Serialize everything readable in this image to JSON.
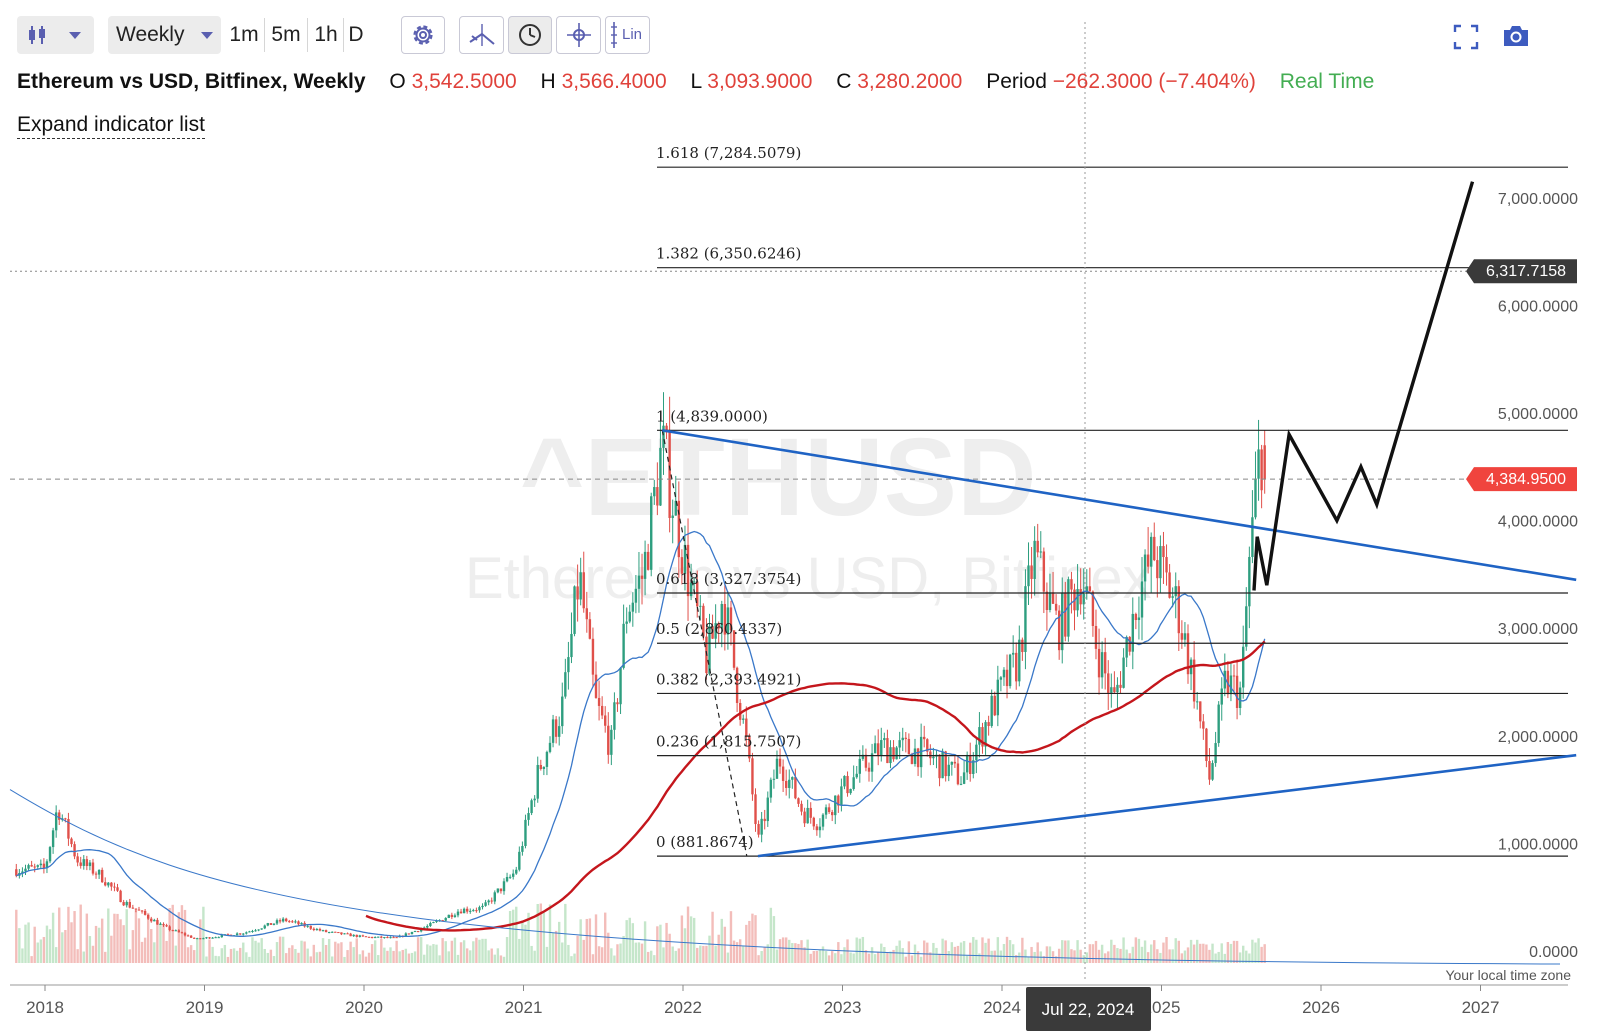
{
  "toolbar": {
    "chart_type_icon": "candlestick-icon",
    "timeframe": "Weekly",
    "intervals": [
      "1m",
      "5m",
      "1h",
      "D"
    ],
    "tools": [
      "gear-icon",
      "draw-tool-icon",
      "clock-icon",
      "crosshair-icon",
      "lin-scale-icon"
    ],
    "lin_label": "Lin",
    "fullscreen_icon": "fullscreen-icon",
    "camera_icon": "camera-icon"
  },
  "legend": {
    "title": "Ethereum vs USD, Bitfinex, Weekly",
    "open_label": "O",
    "open": "3,542.5000",
    "high_label": "H",
    "high": "3,566.4000",
    "low_label": "L",
    "low": "3,093.9000",
    "close_label": "C",
    "close": "3,280.2000",
    "period_label": "Period",
    "period": "−262.3000 (−7.404%)",
    "realtime": "Real Time",
    "expand": "Expand indicator list"
  },
  "watermark": {
    "symbol": "^ETHUSD",
    "name": "Ethereum vs USD, Bitfinex"
  },
  "colors": {
    "up": "#2e9e7f",
    "down": "#e0504a",
    "trendline": "#1f63c4",
    "ma_long": "#c4161c",
    "ma_short": "#3a78c9",
    "projection": "#111111",
    "price_tag": "#f0443e",
    "crosshair_tag": "#3a3a3a"
  },
  "chart_data": {
    "type": "candlestick",
    "symbol": "Ethereum vs USD, Bitfinex",
    "interval": "Weekly",
    "x_ticks": [
      "2018",
      "2019",
      "2020",
      "2021",
      "2022",
      "2023",
      "2024",
      "2025",
      "2026",
      "2027"
    ],
    "y_ticks": [
      "7,000.0000",
      "6,000.0000",
      "5,000.0000",
      "4,000.0000",
      "3,000.0000",
      "2,000.0000",
      "1,000.0000",
      "0.0000"
    ],
    "ylim": [
      0,
      7600
    ],
    "timezone_note": "Your local time zone",
    "crosshair_date": "Jul 22, 2024",
    "crosshair_price": "6,317.7158",
    "last_price": "4,384.9500",
    "fibonacci": [
      {
        "level": "1.618 (7,284.5079)",
        "value": 7284.5079
      },
      {
        "level": "1.382 (6,350.6246)",
        "value": 6350.6246
      },
      {
        "level": "1 (4,839.0000)",
        "value": 4839.0
      },
      {
        "level": "0.618 (3,327.3754)",
        "value": 3327.3754
      },
      {
        "level": "0.5 (2,860.4337)",
        "value": 2860.4337
      },
      {
        "level": "0.382 (2,393.4921)",
        "value": 2393.4921
      },
      {
        "level": "0.236 (1,815.7507)",
        "value": 1815.7507
      },
      {
        "level": "0 (881.8674)",
        "value": 881.8674
      }
    ],
    "price_path": [
      [
        2018.0,
        760
      ],
      [
        2018.08,
        1350
      ],
      [
        2018.2,
        850
      ],
      [
        2018.35,
        700
      ],
      [
        2018.5,
        450
      ],
      [
        2018.75,
        220
      ],
      [
        2018.95,
        110
      ],
      [
        2019.25,
        170
      ],
      [
        2019.5,
        290
      ],
      [
        2019.75,
        180
      ],
      [
        2020.0,
        130
      ],
      [
        2020.2,
        120
      ],
      [
        2020.4,
        230
      ],
      [
        2020.6,
        380
      ],
      [
        2020.75,
        400
      ],
      [
        2020.95,
        740
      ],
      [
        2021.1,
        1700
      ],
      [
        2021.25,
        2300
      ],
      [
        2021.35,
        3500
      ],
      [
        2021.45,
        2300
      ],
      [
        2021.55,
        1900
      ],
      [
        2021.65,
        3200
      ],
      [
        2021.75,
        3500
      ],
      [
        2021.87,
        4700
      ],
      [
        2022.0,
        3700
      ],
      [
        2022.15,
        2700
      ],
      [
        2022.25,
        3300
      ],
      [
        2022.4,
        1900
      ],
      [
        2022.47,
        1000
      ],
      [
        2022.6,
        1800
      ],
      [
        2022.75,
        1300
      ],
      [
        2022.85,
        1200
      ],
      [
        2023.0,
        1500
      ],
      [
        2023.25,
        1900
      ],
      [
        2023.5,
        1850
      ],
      [
        2023.75,
        1600
      ],
      [
        2023.95,
        2300
      ],
      [
        2024.1,
        2700
      ],
      [
        2024.2,
        3700
      ],
      [
        2024.35,
        3000
      ],
      [
        2024.5,
        3500
      ],
      [
        2024.6,
        2800
      ],
      [
        2024.7,
        2300
      ],
      [
        2024.85,
        3300
      ],
      [
        2024.95,
        3700
      ],
      [
        2025.1,
        3200
      ],
      [
        2025.2,
        2500
      ],
      [
        2025.3,
        1600
      ],
      [
        2025.4,
        2500
      ],
      [
        2025.5,
        2400
      ],
      [
        2025.55,
        3600
      ],
      [
        2025.62,
        4700
      ],
      [
        2025.66,
        4385
      ]
    ],
    "projection": [
      [
        2025.58,
        3350
      ],
      [
        2025.6,
        3850
      ],
      [
        2025.66,
        3400
      ],
      [
        2025.8,
        4800
      ],
      [
        2026.1,
        4000
      ],
      [
        2026.25,
        4500
      ],
      [
        2026.35,
        4150
      ],
      [
        2026.95,
        7150
      ]
    ],
    "trendline_upper": [
      [
        2021.87,
        4839
      ],
      [
        2027.6,
        3450
      ]
    ],
    "trendline_lower": [
      [
        2022.47,
        881.9
      ],
      [
        2027.6,
        1820
      ]
    ]
  }
}
